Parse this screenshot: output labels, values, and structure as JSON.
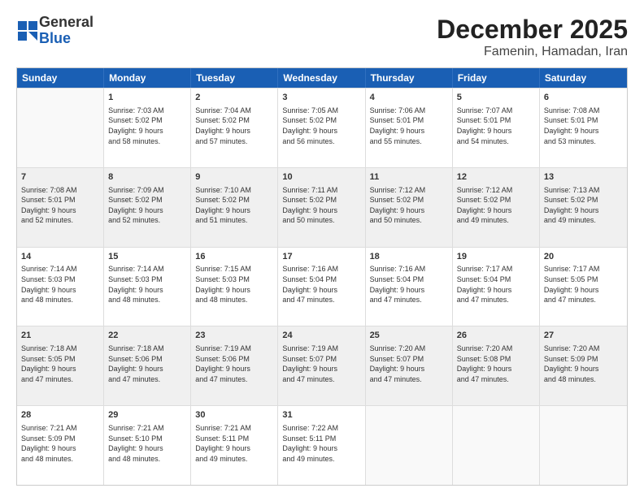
{
  "logo": {
    "general": "General",
    "blue": "Blue",
    "icon": "▶"
  },
  "title": "December 2025",
  "subtitle": "Famenin, Hamadan, Iran",
  "headers": [
    "Sunday",
    "Monday",
    "Tuesday",
    "Wednesday",
    "Thursday",
    "Friday",
    "Saturday"
  ],
  "rows": [
    [
      {
        "day": "",
        "lines": []
      },
      {
        "day": "1",
        "lines": [
          "Sunrise: 7:03 AM",
          "Sunset: 5:02 PM",
          "Daylight: 9 hours",
          "and 58 minutes."
        ]
      },
      {
        "day": "2",
        "lines": [
          "Sunrise: 7:04 AM",
          "Sunset: 5:02 PM",
          "Daylight: 9 hours",
          "and 57 minutes."
        ]
      },
      {
        "day": "3",
        "lines": [
          "Sunrise: 7:05 AM",
          "Sunset: 5:02 PM",
          "Daylight: 9 hours",
          "and 56 minutes."
        ]
      },
      {
        "day": "4",
        "lines": [
          "Sunrise: 7:06 AM",
          "Sunset: 5:01 PM",
          "Daylight: 9 hours",
          "and 55 minutes."
        ]
      },
      {
        "day": "5",
        "lines": [
          "Sunrise: 7:07 AM",
          "Sunset: 5:01 PM",
          "Daylight: 9 hours",
          "and 54 minutes."
        ]
      },
      {
        "day": "6",
        "lines": [
          "Sunrise: 7:08 AM",
          "Sunset: 5:01 PM",
          "Daylight: 9 hours",
          "and 53 minutes."
        ]
      }
    ],
    [
      {
        "day": "7",
        "lines": [
          "Sunrise: 7:08 AM",
          "Sunset: 5:01 PM",
          "Daylight: 9 hours",
          "and 52 minutes."
        ]
      },
      {
        "day": "8",
        "lines": [
          "Sunrise: 7:09 AM",
          "Sunset: 5:02 PM",
          "Daylight: 9 hours",
          "and 52 minutes."
        ]
      },
      {
        "day": "9",
        "lines": [
          "Sunrise: 7:10 AM",
          "Sunset: 5:02 PM",
          "Daylight: 9 hours",
          "and 51 minutes."
        ]
      },
      {
        "day": "10",
        "lines": [
          "Sunrise: 7:11 AM",
          "Sunset: 5:02 PM",
          "Daylight: 9 hours",
          "and 50 minutes."
        ]
      },
      {
        "day": "11",
        "lines": [
          "Sunrise: 7:12 AM",
          "Sunset: 5:02 PM",
          "Daylight: 9 hours",
          "and 50 minutes."
        ]
      },
      {
        "day": "12",
        "lines": [
          "Sunrise: 7:12 AM",
          "Sunset: 5:02 PM",
          "Daylight: 9 hours",
          "and 49 minutes."
        ]
      },
      {
        "day": "13",
        "lines": [
          "Sunrise: 7:13 AM",
          "Sunset: 5:02 PM",
          "Daylight: 9 hours",
          "and 49 minutes."
        ]
      }
    ],
    [
      {
        "day": "14",
        "lines": [
          "Sunrise: 7:14 AM",
          "Sunset: 5:03 PM",
          "Daylight: 9 hours",
          "and 48 minutes."
        ]
      },
      {
        "day": "15",
        "lines": [
          "Sunrise: 7:14 AM",
          "Sunset: 5:03 PM",
          "Daylight: 9 hours",
          "and 48 minutes."
        ]
      },
      {
        "day": "16",
        "lines": [
          "Sunrise: 7:15 AM",
          "Sunset: 5:03 PM",
          "Daylight: 9 hours",
          "and 48 minutes."
        ]
      },
      {
        "day": "17",
        "lines": [
          "Sunrise: 7:16 AM",
          "Sunset: 5:04 PM",
          "Daylight: 9 hours",
          "and 47 minutes."
        ]
      },
      {
        "day": "18",
        "lines": [
          "Sunrise: 7:16 AM",
          "Sunset: 5:04 PM",
          "Daylight: 9 hours",
          "and 47 minutes."
        ]
      },
      {
        "day": "19",
        "lines": [
          "Sunrise: 7:17 AM",
          "Sunset: 5:04 PM",
          "Daylight: 9 hours",
          "and 47 minutes."
        ]
      },
      {
        "day": "20",
        "lines": [
          "Sunrise: 7:17 AM",
          "Sunset: 5:05 PM",
          "Daylight: 9 hours",
          "and 47 minutes."
        ]
      }
    ],
    [
      {
        "day": "21",
        "lines": [
          "Sunrise: 7:18 AM",
          "Sunset: 5:05 PM",
          "Daylight: 9 hours",
          "and 47 minutes."
        ]
      },
      {
        "day": "22",
        "lines": [
          "Sunrise: 7:18 AM",
          "Sunset: 5:06 PM",
          "Daylight: 9 hours",
          "and 47 minutes."
        ]
      },
      {
        "day": "23",
        "lines": [
          "Sunrise: 7:19 AM",
          "Sunset: 5:06 PM",
          "Daylight: 9 hours",
          "and 47 minutes."
        ]
      },
      {
        "day": "24",
        "lines": [
          "Sunrise: 7:19 AM",
          "Sunset: 5:07 PM",
          "Daylight: 9 hours",
          "and 47 minutes."
        ]
      },
      {
        "day": "25",
        "lines": [
          "Sunrise: 7:20 AM",
          "Sunset: 5:07 PM",
          "Daylight: 9 hours",
          "and 47 minutes."
        ]
      },
      {
        "day": "26",
        "lines": [
          "Sunrise: 7:20 AM",
          "Sunset: 5:08 PM",
          "Daylight: 9 hours",
          "and 47 minutes."
        ]
      },
      {
        "day": "27",
        "lines": [
          "Sunrise: 7:20 AM",
          "Sunset: 5:09 PM",
          "Daylight: 9 hours",
          "and 48 minutes."
        ]
      }
    ],
    [
      {
        "day": "28",
        "lines": [
          "Sunrise: 7:21 AM",
          "Sunset: 5:09 PM",
          "Daylight: 9 hours",
          "and 48 minutes."
        ]
      },
      {
        "day": "29",
        "lines": [
          "Sunrise: 7:21 AM",
          "Sunset: 5:10 PM",
          "Daylight: 9 hours",
          "and 48 minutes."
        ]
      },
      {
        "day": "30",
        "lines": [
          "Sunrise: 7:21 AM",
          "Sunset: 5:11 PM",
          "Daylight: 9 hours",
          "and 49 minutes."
        ]
      },
      {
        "day": "31",
        "lines": [
          "Sunrise: 7:22 AM",
          "Sunset: 5:11 PM",
          "Daylight: 9 hours",
          "and 49 minutes."
        ]
      },
      {
        "day": "",
        "lines": []
      },
      {
        "day": "",
        "lines": []
      },
      {
        "day": "",
        "lines": []
      }
    ]
  ]
}
